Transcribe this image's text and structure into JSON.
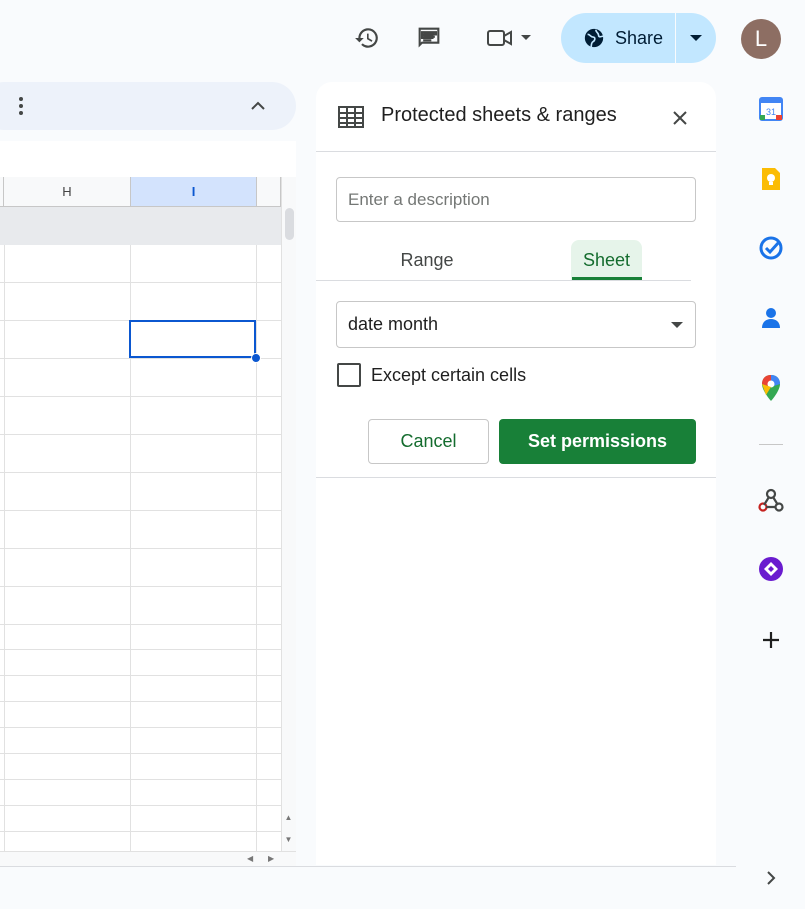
{
  "topbar": {
    "share_label": "Share",
    "avatar_letter": "L"
  },
  "sheet": {
    "columns": [
      {
        "label": "H",
        "selected": false
      },
      {
        "label": "I",
        "selected": true
      }
    ]
  },
  "panel": {
    "title": "Protected sheets & ranges",
    "description_placeholder": "Enter a description",
    "tabs": {
      "range": "Range",
      "sheet": "Sheet",
      "active": "Sheet"
    },
    "sheet_select_value": "date month",
    "except_cells_label": "Except certain cells",
    "except_cells_checked": false,
    "cancel_label": "Cancel",
    "set_permissions_label": "Set permissions"
  },
  "colors": {
    "accent_green": "#188038",
    "share_bg": "#c2e7ff",
    "selection_blue": "#0b57d0"
  },
  "side_rail": [
    "calendar-icon",
    "keep-icon",
    "tasks-icon",
    "contacts-icon",
    "maps-icon",
    "webhook-addon-icon",
    "purple-addon-icon",
    "add-icon"
  ]
}
